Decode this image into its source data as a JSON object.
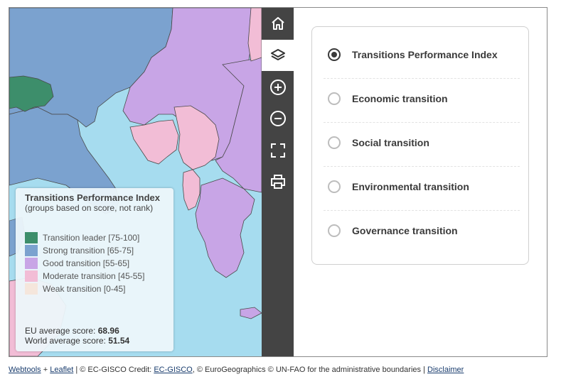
{
  "map": {
    "legend": {
      "title": "Transitions Performance Index",
      "subtitle": "(groups based on score, not rank)",
      "items": [
        {
          "label": "Transition leader [75-100]",
          "color": "#3d8e6b"
        },
        {
          "label": "Strong transition [65-75]",
          "color": "#7ba2cf"
        },
        {
          "label": "Good transition [55-65]",
          "color": "#c8a5e6"
        },
        {
          "label": "Moderate transition [45-55]",
          "color": "#f2bdd6"
        },
        {
          "label": "Weak transition [0-45]",
          "color": "#f5e6dc"
        }
      ],
      "eu_avg_label": "EU average score:",
      "eu_avg_value": "68.96",
      "world_avg_label": "World average score:",
      "world_avg_value": "51.54"
    },
    "colors": {
      "sea": "#a6dcef",
      "border": "#4a4a4a"
    }
  },
  "toolbar": {
    "tools": [
      {
        "name": "home-button",
        "icon": "home-icon"
      },
      {
        "name": "layers-button",
        "icon": "layers-icon",
        "active": true
      },
      {
        "name": "zoom-in-button",
        "icon": "zoom-in-icon"
      },
      {
        "name": "zoom-out-button",
        "icon": "zoom-out-icon"
      },
      {
        "name": "fullscreen-button",
        "icon": "fullscreen-icon"
      },
      {
        "name": "print-button",
        "icon": "print-icon"
      }
    ]
  },
  "layers": {
    "selected": 0,
    "options": [
      {
        "label": "Transitions Performance Index"
      },
      {
        "label": "Economic transition"
      },
      {
        "label": "Social transition"
      },
      {
        "label": "Environmental transition"
      },
      {
        "label": "Governance transition"
      }
    ]
  },
  "footer": {
    "webtools": "Webtools",
    "plus": "+",
    "leaflet": "Leaflet",
    "credit_prefix": "| © EC-GISCO Credit:",
    "ec_gisco": "EC-GISCO",
    "credit_suffix": ", © EuroGeographics © UN-FAO for the administrative boundaries |",
    "disclaimer": "Disclaimer"
  }
}
